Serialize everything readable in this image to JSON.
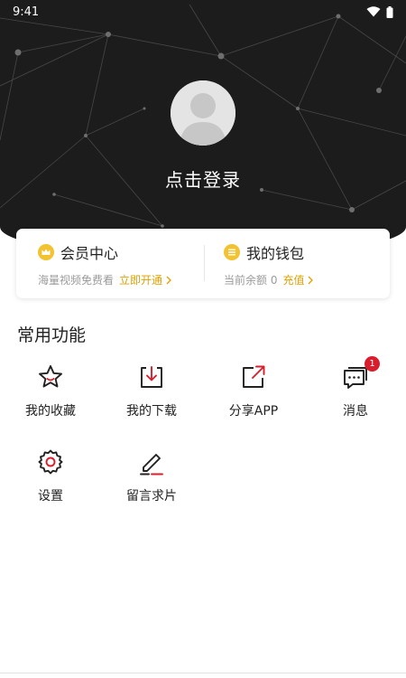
{
  "status_bar": {
    "time": "9:41"
  },
  "profile": {
    "login_prompt": "点击登录"
  },
  "member_card": {
    "title": "会员中心",
    "subtitle": "海量视频免费看",
    "action": "立即开通",
    "icon": "crown-icon"
  },
  "wallet_card": {
    "title": "我的钱包",
    "balance_label": "当前余额 0",
    "action": "充值",
    "icon": "wallet-coin-icon"
  },
  "functions": {
    "title": "常用功能",
    "items": [
      {
        "label": "我的收藏",
        "icon": "star-icon"
      },
      {
        "label": "我的下载",
        "icon": "download-icon"
      },
      {
        "label": "分享APP",
        "icon": "share-icon"
      },
      {
        "label": "消息",
        "icon": "message-icon",
        "badge": "1"
      },
      {
        "label": "设置",
        "icon": "gear-icon"
      },
      {
        "label": "留言求片",
        "icon": "edit-icon"
      }
    ]
  },
  "colors": {
    "accent": "#e0a100",
    "badge": "#d81e2c",
    "header_bg": "#1c1c1c"
  }
}
